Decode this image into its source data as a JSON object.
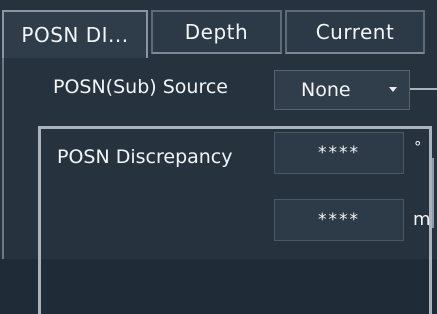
{
  "tabs": [
    {
      "label": "POSN DI...",
      "active": true
    },
    {
      "label": "Depth",
      "active": false
    },
    {
      "label": "Current",
      "active": false
    }
  ],
  "source": {
    "label": "POSN(Sub) Source",
    "value": "None"
  },
  "discrepancy": {
    "label": "POSN Discrepancy",
    "angle_value": "****",
    "angle_unit": "°",
    "distance_value": "****",
    "distance_unit": "m"
  },
  "colors": {
    "background": "#26333f",
    "tab_border": "#5e6c79",
    "group_border": "#aab3bc",
    "text": "#f2f4f6"
  },
  "icons": {
    "dropdown": "caret-down-icon"
  }
}
